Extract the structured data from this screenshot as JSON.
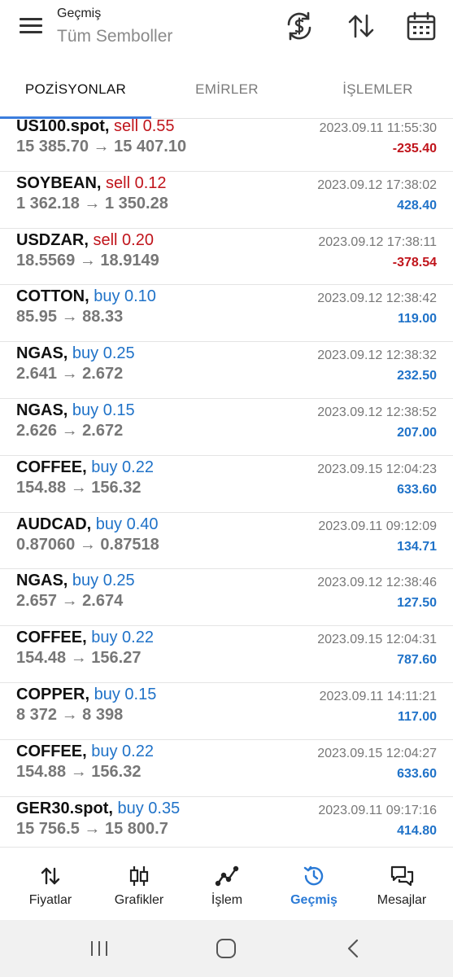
{
  "header": {
    "title": "Geçmiş",
    "subtitle": "Tüm Semboller",
    "icons": [
      "menu-icon",
      "currency-sync-icon",
      "sort-icon",
      "calendar-icon"
    ]
  },
  "tabs": [
    {
      "label": "POZİSYONLAR",
      "active": true
    },
    {
      "label": "EMİRLER",
      "active": false
    },
    {
      "label": "İŞLEMLER",
      "active": false
    }
  ],
  "rows": [
    {
      "symbol": "US100.spot,",
      "side": "sell 0.55",
      "type": "sell",
      "prices": "15 385.70 → 15 407.10",
      "time": "2023.09.11 11:55:30",
      "profit": "-235.40",
      "sign": "neg"
    },
    {
      "symbol": "SOYBEAN,",
      "side": "sell 0.12",
      "type": "sell",
      "prices": "1 362.18 → 1 350.28",
      "time": "2023.09.12 17:38:02",
      "profit": "428.40",
      "sign": "pos"
    },
    {
      "symbol": "USDZAR,",
      "side": "sell 0.20",
      "type": "sell",
      "prices": "18.5569 → 18.9149",
      "time": "2023.09.12 17:38:11",
      "profit": "-378.54",
      "sign": "neg"
    },
    {
      "symbol": "COTTON,",
      "side": "buy 0.10",
      "type": "buy",
      "prices": "85.95 → 88.33",
      "time": "2023.09.12 12:38:42",
      "profit": "119.00",
      "sign": "pos"
    },
    {
      "symbol": "NGAS,",
      "side": "buy 0.25",
      "type": "buy",
      "prices": "2.641 → 2.672",
      "time": "2023.09.12 12:38:32",
      "profit": "232.50",
      "sign": "pos"
    },
    {
      "symbol": "NGAS,",
      "side": "buy 0.15",
      "type": "buy",
      "prices": "2.626 → 2.672",
      "time": "2023.09.12 12:38:52",
      "profit": "207.00",
      "sign": "pos"
    },
    {
      "symbol": "COFFEE,",
      "side": "buy 0.22",
      "type": "buy",
      "prices": "154.88 → 156.32",
      "time": "2023.09.15 12:04:23",
      "profit": "633.60",
      "sign": "pos"
    },
    {
      "symbol": "AUDCAD,",
      "side": "buy 0.40",
      "type": "buy",
      "prices": "0.87060 → 0.87518",
      "time": "2023.09.11 09:12:09",
      "profit": "134.71",
      "sign": "pos"
    },
    {
      "symbol": "NGAS,",
      "side": "buy 0.25",
      "type": "buy",
      "prices": "2.657 → 2.674",
      "time": "2023.09.12 12:38:46",
      "profit": "127.50",
      "sign": "pos"
    },
    {
      "symbol": "COFFEE,",
      "side": "buy 0.22",
      "type": "buy",
      "prices": "154.48 → 156.27",
      "time": "2023.09.15 12:04:31",
      "profit": "787.60",
      "sign": "pos"
    },
    {
      "symbol": "COPPER,",
      "side": "buy 0.15",
      "type": "buy",
      "prices": "8 372 → 8 398",
      "time": "2023.09.11 14:11:21",
      "profit": "117.00",
      "sign": "pos"
    },
    {
      "symbol": "COFFEE,",
      "side": "buy 0.22",
      "type": "buy",
      "prices": "154.88 → 156.32",
      "time": "2023.09.15 12:04:27",
      "profit": "633.60",
      "sign": "pos"
    },
    {
      "symbol": "GER30.spot,",
      "side": "buy 0.35",
      "type": "buy",
      "prices": "15 756.5 → 15 800.7",
      "time": "2023.09.11 09:17:16",
      "profit": "414.80",
      "sign": "pos"
    }
  ],
  "bottom_nav": [
    {
      "label": "Fiyatlar",
      "icon": "quotes-icon",
      "active": false
    },
    {
      "label": "Grafikler",
      "icon": "candlestick-chart-icon",
      "active": false
    },
    {
      "label": "İşlem",
      "icon": "trade-line-icon",
      "active": false
    },
    {
      "label": "Geçmiş",
      "icon": "history-icon",
      "active": true
    },
    {
      "label": "Mesajlar",
      "icon": "messages-icon",
      "active": false
    }
  ],
  "colors": {
    "accent": "#2a7ad6",
    "sell": "#c0141b",
    "buy": "#1f72c8",
    "muted": "#777777"
  }
}
